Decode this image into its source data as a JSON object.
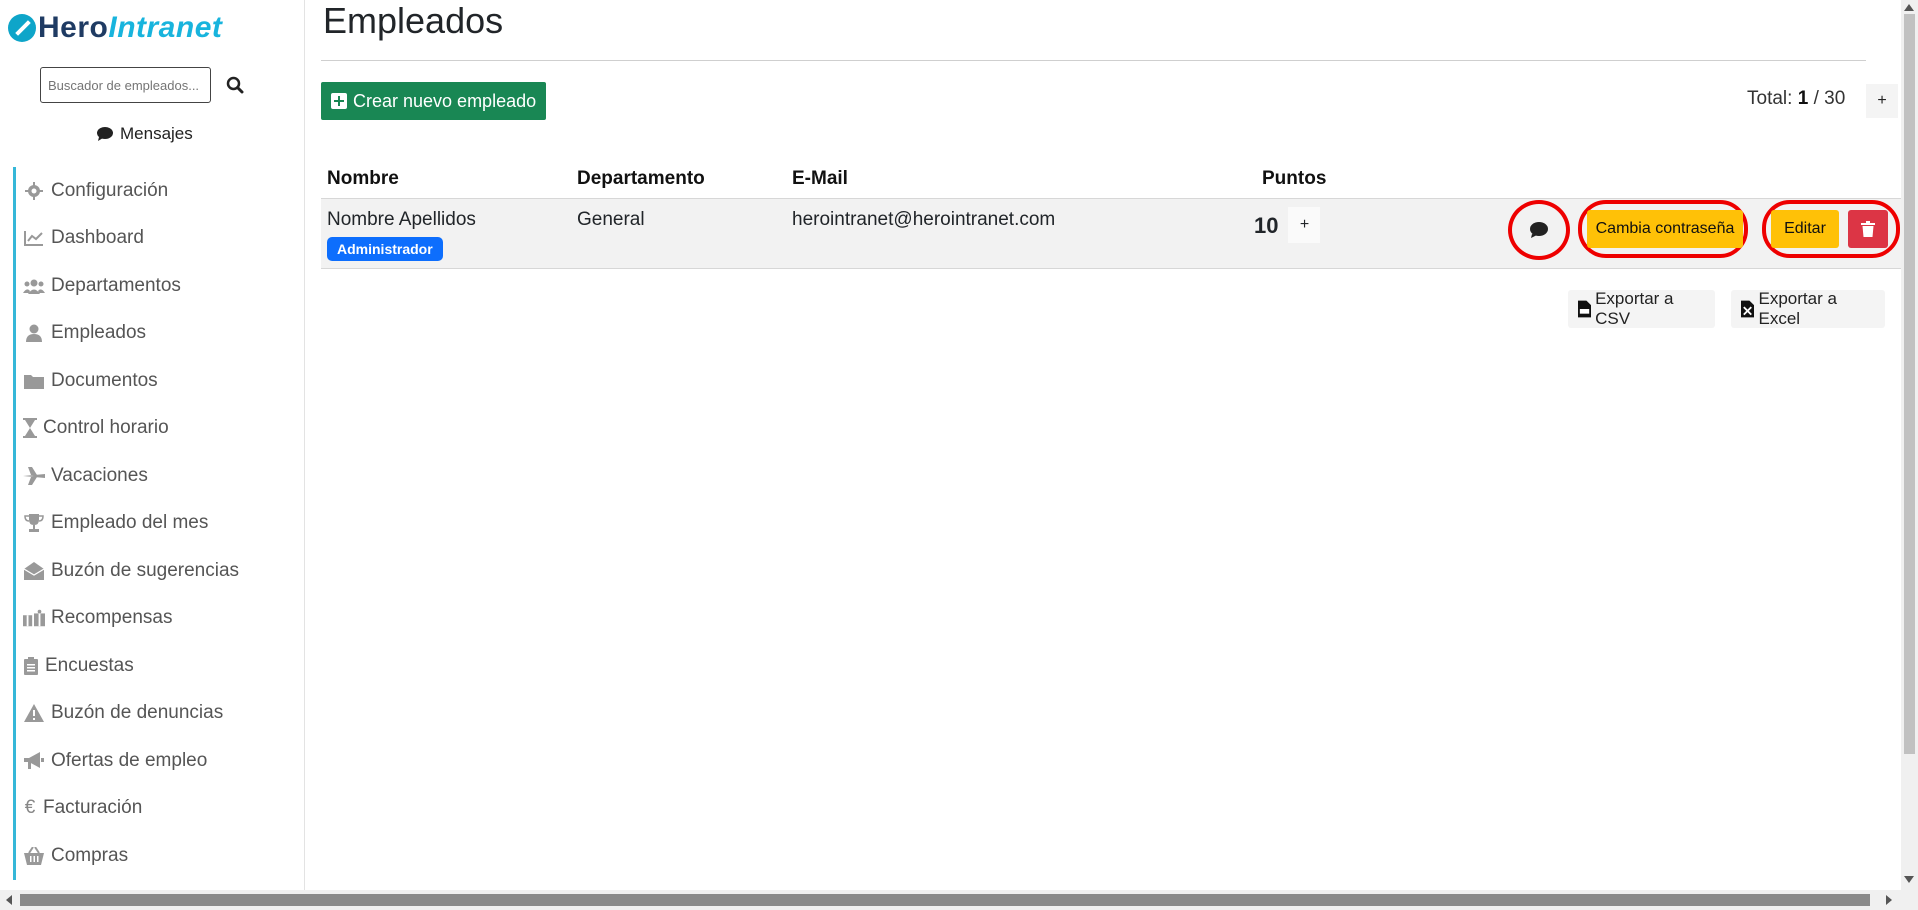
{
  "app": {
    "logo_part1": "Hero",
    "logo_part2": "Intranet",
    "brand_color": "#18b4dd"
  },
  "sidebar": {
    "search_placeholder": "Buscador de empleados...",
    "messages_label": "Mensajes",
    "items": [
      {
        "label": "Configuración",
        "icon": "gear-icon"
      },
      {
        "label": "Dashboard",
        "icon": "chart-line-icon"
      },
      {
        "label": "Departamentos",
        "icon": "users-icon"
      },
      {
        "label": "Empleados",
        "icon": "user-icon"
      },
      {
        "label": "Documentos",
        "icon": "folder-icon"
      },
      {
        "label": "Control horario",
        "icon": "hourglass-icon"
      },
      {
        "label": "Vacaciones",
        "icon": "plane-icon"
      },
      {
        "label": "Empleado del mes",
        "icon": "trophy-icon"
      },
      {
        "label": "Buzón de sugerencias",
        "icon": "envelope-open-icon"
      },
      {
        "label": "Recompensas",
        "icon": "gifts-icon"
      },
      {
        "label": "Encuestas",
        "icon": "clipboard-icon"
      },
      {
        "label": "Buzón de denuncias",
        "icon": "warning-icon"
      },
      {
        "label": "Ofertas de empleo",
        "icon": "megaphone-icon"
      },
      {
        "label": "Facturación",
        "icon": "euro-icon"
      },
      {
        "label": "Compras",
        "icon": "basket-icon"
      }
    ]
  },
  "main": {
    "title": "Empleados",
    "create_button": "Crear nuevo empleado",
    "total_label": "Total:",
    "total_current": "1",
    "total_separator": "/",
    "total_max": "30",
    "page_plus": "+",
    "table": {
      "headers": [
        "Nombre",
        "Departamento",
        "E-Mail",
        "Puntos"
      ],
      "rows": [
        {
          "name": "Nombre Apellidos",
          "role_badge": "Administrador",
          "department": "General",
          "email": "herointranet@herointranet.com",
          "points": "10",
          "points_plus": "+"
        }
      ]
    },
    "actions": {
      "change_password": "Cambia contraseña",
      "edit": "Editar"
    },
    "exports": {
      "csv": "Exportar a CSV",
      "excel": "Exportar a Excel"
    }
  }
}
